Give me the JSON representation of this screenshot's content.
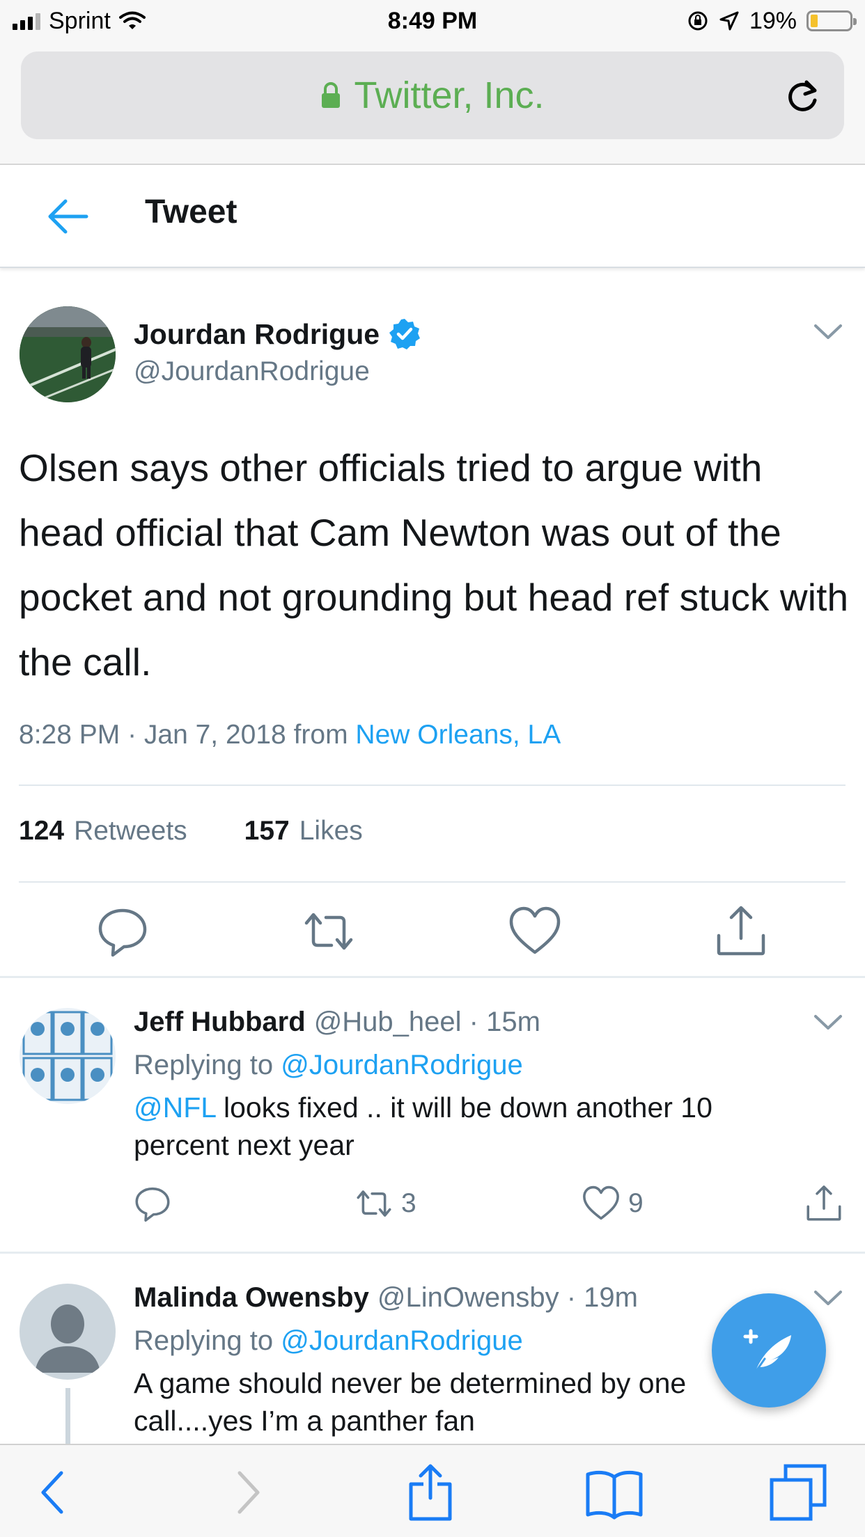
{
  "status_bar": {
    "carrier": "Sprint",
    "time": "8:49 PM",
    "battery_percent": "19%",
    "battery_level": 0.19,
    "battery_color": "#f5c12b"
  },
  "browser": {
    "site_name": "Twitter, Inc.",
    "secure_color": "#5cae53",
    "icons": [
      "lock-icon",
      "reload-icon",
      "back-icon",
      "forward-icon",
      "share-icon",
      "bookmarks-icon",
      "tabs-icon"
    ]
  },
  "header": {
    "title": "Tweet"
  },
  "tweet": {
    "author_name": "Jourdan Rodrigue",
    "author_handle": "@JourdanRodrigue",
    "verified": true,
    "text": "Olsen says other officials tried to argue with head official that Cam Newton was out of the pocket and not grounding but head ref stuck with the call.",
    "timestamp": "8:28 PM · Jan 7, 2018 from",
    "location": "New Orleans, LA",
    "retweets_count": "124",
    "retweets_label": "Retweets",
    "likes_count": "157",
    "likes_label": "Likes"
  },
  "replies": [
    {
      "name": "Jeff Hubbard",
      "handle": "@Hub_heel",
      "time": "· 15m",
      "replying_prefix": "Replying to",
      "replying_to": "@JourdanRodrigue",
      "mention": "@NFL",
      "text": " looks fixed .. it will be down another 10 percent next year",
      "retweets": "3",
      "likes": "9"
    },
    {
      "name": "Malinda Owensby",
      "handle": "@LinOwensby",
      "time": "· 19m",
      "replying_prefix": "Replying to",
      "replying_to": "@JourdanRodrigue",
      "text": "A game should never be determined by one call....yes I’m a panther fan"
    }
  ],
  "colors": {
    "twitter_blue": "#1da1f2",
    "fab_blue": "#3f9ee9",
    "secondary_text": "#657786"
  }
}
